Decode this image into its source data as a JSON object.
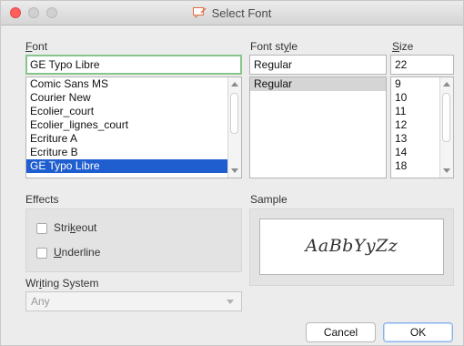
{
  "window": {
    "title": "Select Font"
  },
  "font": {
    "label_prefix": "",
    "label_acc": "F",
    "label_suffix": "ont",
    "value": "GE Typo Libre",
    "items": [
      "Comic Sans MS",
      "Courier New",
      "Ecolier_court",
      "Ecolier_lignes_court",
      "Ecriture A",
      "Ecriture B",
      "GE Typo Libre"
    ],
    "selected_index": 6
  },
  "style": {
    "label_prefix": "Font st",
    "label_acc": "y",
    "label_suffix": "le",
    "value": "Regular",
    "items": [
      "Regular"
    ]
  },
  "size": {
    "label_prefix": "",
    "label_acc": "S",
    "label_suffix": "ize",
    "value": "22",
    "items": [
      "9",
      "10",
      "11",
      "12",
      "13",
      "14",
      "18"
    ]
  },
  "effects": {
    "title": "Effects",
    "strikeout_prefix": "Stri",
    "strikeout_acc": "k",
    "strikeout_suffix": "eout",
    "underline_prefix": "",
    "underline_acc": "U",
    "underline_suffix": "nderline"
  },
  "writing_system": {
    "label_prefix": "Wr",
    "label_acc": "i",
    "label_suffix": "ting System",
    "value": "Any"
  },
  "sample": {
    "title": "Sample",
    "text": "AaBbYyZz"
  },
  "buttons": {
    "cancel": "Cancel",
    "ok": "OK"
  },
  "colors": {
    "selection": "#1f5ecf",
    "focus_ring": "#86c58b",
    "close": "#fc605c"
  }
}
